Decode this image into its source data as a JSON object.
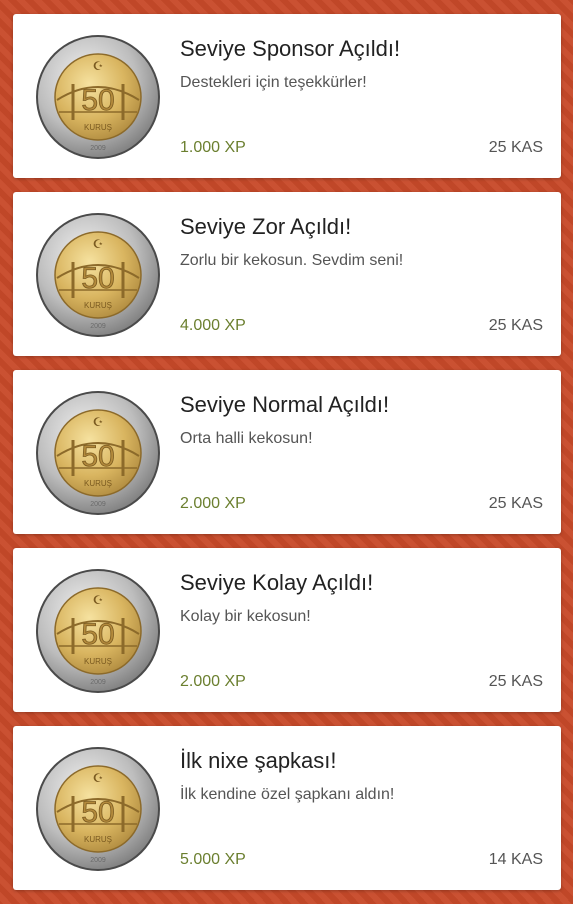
{
  "achievements": [
    {
      "title": "Seviye Sponsor Açıldı!",
      "description": "Destekleri için teşekkürler!",
      "xp": "1.000 XP",
      "date": "25 KAS",
      "icon": "coin-50-kurus-icon"
    },
    {
      "title": "Seviye Zor Açıldı!",
      "description": "Zorlu bir kekosun. Sevdim seni!",
      "xp": "4.000 XP",
      "date": "25 KAS",
      "icon": "coin-50-kurus-icon"
    },
    {
      "title": "Seviye Normal Açıldı!",
      "description": "Orta halli kekosun!",
      "xp": "2.000 XP",
      "date": "25 KAS",
      "icon": "coin-50-kurus-icon"
    },
    {
      "title": "Seviye Kolay Açıldı!",
      "description": "Kolay bir kekosun!",
      "xp": "2.000 XP",
      "date": "25 KAS",
      "icon": "coin-50-kurus-icon"
    },
    {
      "title": "İlk nixe şapkası!",
      "description": "İlk kendine özel şapkanı aldın!",
      "xp": "5.000 XP",
      "date": "14 KAS",
      "icon": "coin-50-kurus-icon"
    }
  ],
  "coin": {
    "value_text": "50",
    "unit_text": "KURUŞ",
    "year_text": "2009"
  },
  "colors": {
    "background": "#c84a2a",
    "xp_text": "#6b7f2f"
  }
}
